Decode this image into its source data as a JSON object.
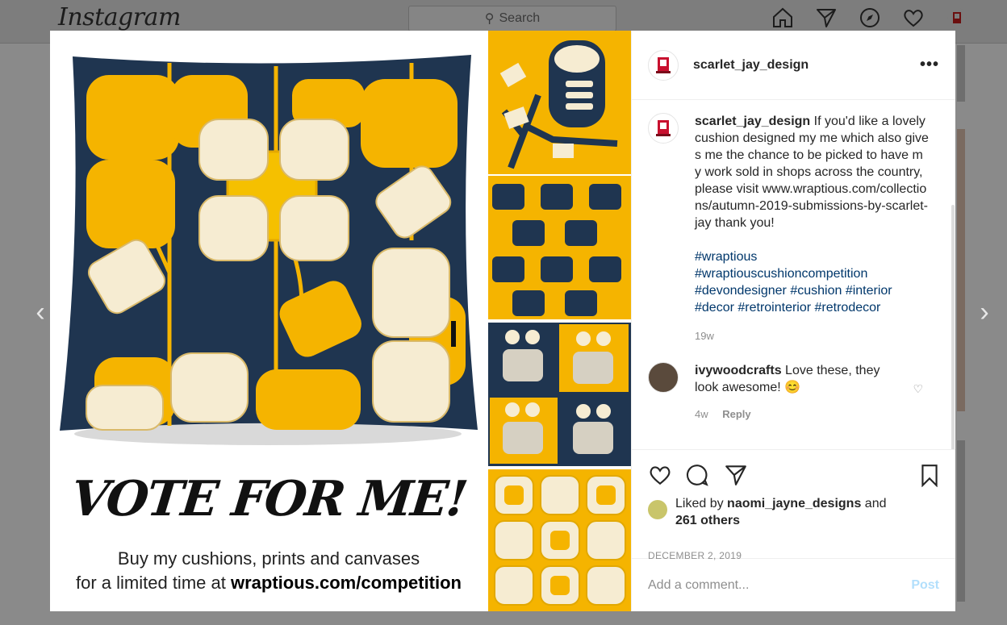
{
  "app": {
    "logo": "Instagram"
  },
  "search": {
    "placeholder": "Search"
  },
  "post": {
    "author": "scarlet_jay_design",
    "caption": {
      "username": "scarlet_jay_design",
      "text": "If you'd like a lovely cushion designed my me which also gives me the chance to be picked to have my work sold in shops across the country, please visit www.wraptious.com/collections/autumn-2019-submissions-by-scarlet-jay thank you!",
      "hashtags": [
        "#wraptious",
        "#wraptiouscushioncompetition",
        "#devondesigner",
        "#cushion",
        "#interior",
        "#decor",
        "#retrointerior",
        "#retrodecor"
      ],
      "age": "19w"
    },
    "comments": [
      {
        "username": "ivywoodcrafts",
        "text": "Love these, they look awesome! 😊",
        "age": "4w",
        "reply_label": "Reply"
      }
    ],
    "likes": {
      "prefix": "Liked by",
      "user": "naomi_jayne_designs",
      "middle": "and",
      "others": "261 others"
    },
    "date": "DECEMBER 2, 2019",
    "comment_box": {
      "placeholder": "Add a comment...",
      "post_label": "Post"
    }
  },
  "image": {
    "headline": "VOTE FOR ME!",
    "line1": "Buy my cushions, prints and canvases",
    "line2_prefix": "for a limited time at",
    "line2_link": "wraptious.com/competition"
  },
  "colors": {
    "mustard": "#f5b400",
    "navy": "#1f3550",
    "cream": "#f6ecd2",
    "link": "#00376b"
  }
}
